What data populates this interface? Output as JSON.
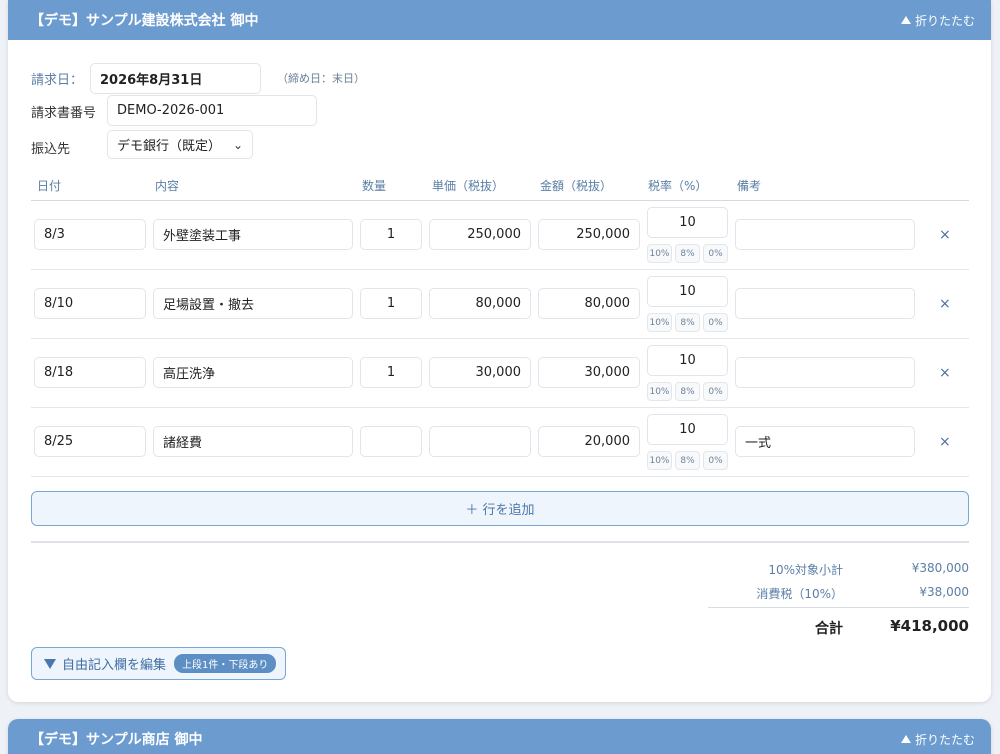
{
  "card1": {
    "title": "【デモ】サンプル建設株式会社 御中",
    "collapse_label": "折りたたむ",
    "billing_date": {
      "label": "請求日：",
      "value": "2026年8月31日",
      "hint": "（締め日：末日）"
    },
    "invoice_no": {
      "label": "請求書番号",
      "value": "DEMO-2026-001"
    },
    "bank": {
      "label": "振込先",
      "value": "デモ銀行（既定）"
    },
    "columns": [
      "日付",
      "内容",
      "数量",
      "単価（税抜）",
      "金額（税抜）",
      "税率（%）",
      "備考"
    ],
    "rows": [
      {
        "date": "8/3",
        "desc": "外壁塗装工事",
        "qty": "1",
        "unit": "250,000",
        "amount": "250,000",
        "tax": "10",
        "note": ""
      },
      {
        "date": "8/10",
        "desc": "足場設置・撤去",
        "qty": "1",
        "unit": "80,000",
        "amount": "80,000",
        "tax": "10",
        "note": ""
      },
      {
        "date": "8/18",
        "desc": "高圧洗浄",
        "qty": "1",
        "unit": "30,000",
        "amount": "30,000",
        "tax": "10",
        "note": ""
      },
      {
        "date": "8/25",
        "desc": "諸経費",
        "qty": "",
        "unit": "",
        "amount": "20,000",
        "tax": "10",
        "note": "一式"
      }
    ],
    "tax_options": [
      "10%",
      "8%",
      "0%"
    ],
    "delete_label": "×",
    "add_row_label": "＋ 行を追加",
    "summary": {
      "subtotal_label": "10%対象小計",
      "subtotal_value": "¥380,000",
      "tax_label": "消費税（10%）",
      "tax_value": "¥38,000",
      "total_label": "合計",
      "total_value": "¥418,000"
    },
    "free_edit": {
      "label": "自由記入欄を編集",
      "badge": "上段1件・下段あり"
    }
  },
  "card2": {
    "title": "【デモ】サンプル商店 御中",
    "collapse_label": "折りたたむ"
  },
  "colors": {
    "header": "#6b9bcf",
    "accent": "#4e77a8"
  }
}
